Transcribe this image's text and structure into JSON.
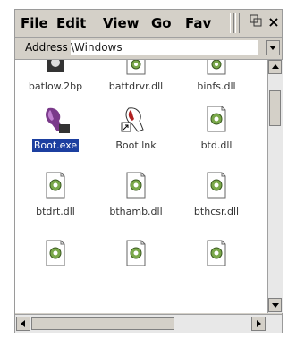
{
  "menu": {
    "file": "File",
    "edit": "Edit",
    "view": "View",
    "go": "Go",
    "favorites": "Fav"
  },
  "toolbar": {
    "icon": "toolbar-icon",
    "close": "×"
  },
  "address": {
    "label": "Address",
    "value": "\\Windows"
  },
  "files": [
    {
      "name": "batlow.2bp",
      "icon": "file-gear-icon"
    },
    {
      "name": "battdrvr.dll",
      "icon": "file-gear-icon"
    },
    {
      "name": "binfs.dll",
      "icon": "file-gear-icon"
    },
    {
      "name": "Boot.exe",
      "icon": "boot-app-icon",
      "selected": true
    },
    {
      "name": "Boot.lnk",
      "icon": "boot-shortcut-icon"
    },
    {
      "name": "btd.dll",
      "icon": "file-gear-icon"
    },
    {
      "name": "btdrt.dll",
      "icon": "file-gear-icon"
    },
    {
      "name": "bthamb.dll",
      "icon": "file-gear-icon"
    },
    {
      "name": "bthcsr.dll",
      "icon": "file-gear-icon"
    },
    {
      "name": "",
      "icon": "file-gear-icon"
    },
    {
      "name": "",
      "icon": "file-gear-icon"
    },
    {
      "name": "",
      "icon": "file-gear-icon"
    }
  ],
  "colors": {
    "selection": "#1c3fa0",
    "chrome": "#d4d0c8",
    "gear": "#7aa84a"
  }
}
